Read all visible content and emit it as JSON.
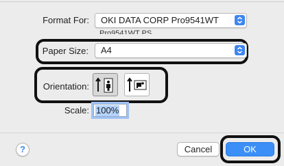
{
  "format_for": {
    "label": "Format For:",
    "value": "OKI DATA CORP Pro9541WT",
    "subtitle": "Pro9541WT PS"
  },
  "paper_size": {
    "label": "Paper Size:",
    "value": "A4"
  },
  "orientation": {
    "label": "Orientation:",
    "options": [
      {
        "name": "portrait",
        "icon": "portrait-icon",
        "selected": true
      },
      {
        "name": "landscape",
        "icon": "landscape-icon",
        "selected": false
      }
    ]
  },
  "scale": {
    "label": "Scale:",
    "value": "100%"
  },
  "help": {
    "label": "?"
  },
  "buttons": {
    "cancel": "Cancel",
    "ok": "OK"
  },
  "colors": {
    "accent": "#3b8ff6",
    "highlight_ring": "#111111",
    "background": "#ececec"
  }
}
